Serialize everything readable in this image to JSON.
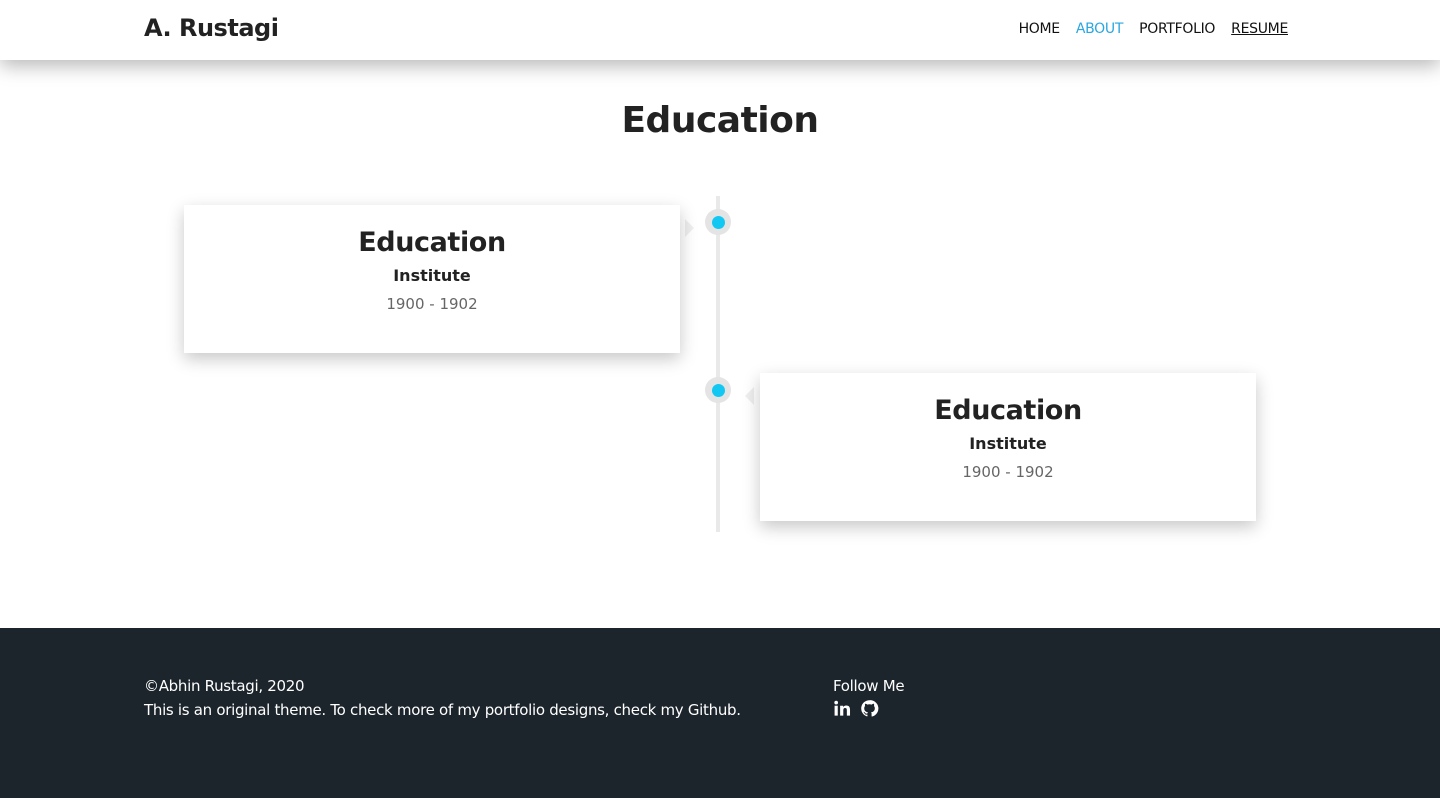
{
  "navbar": {
    "brand": "A. Rustagi",
    "links": [
      {
        "label": "HOME"
      },
      {
        "label": "ABOUT"
      },
      {
        "label": "PORTFOLIO"
      },
      {
        "label": "RESUME"
      }
    ],
    "active_color": "#2aa6e0"
  },
  "section": {
    "title": "Education"
  },
  "timeline": {
    "accent_color": "#12c8f3",
    "items": [
      {
        "title": "Education",
        "subtitle": "Institute",
        "date": "1900 - 1902",
        "side": "left"
      },
      {
        "title": "Education",
        "subtitle": "Institute",
        "date": "1900 - 1902",
        "side": "right"
      }
    ]
  },
  "footer": {
    "copyright": "©Abhin Rustagi, 2020",
    "description": "This is an original theme. To check more of my portfolio designs, check my Github.",
    "follow_title": "Follow Me",
    "social_icons": [
      "linkedin-icon",
      "github-icon"
    ],
    "background": "#1c242c"
  }
}
